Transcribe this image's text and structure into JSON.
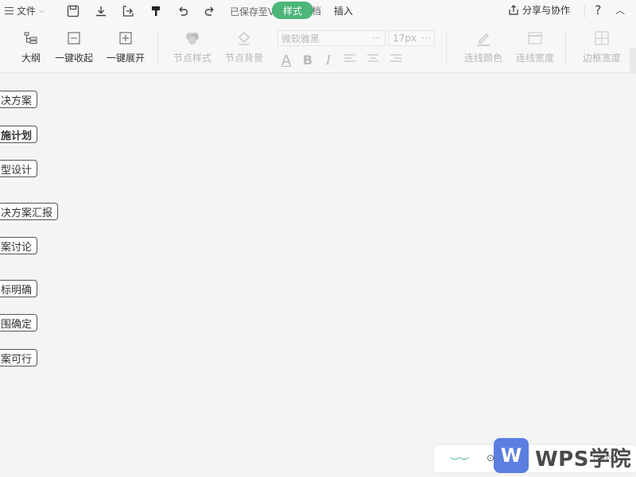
{
  "menubar": {
    "file_label": "文件",
    "saved_text": "已保存至V",
    "tab_style": "样式",
    "tab_hidden_fragment": "档",
    "tab_insert": "插入",
    "share_label": "分享与协作",
    "help_label": "?",
    "collapse_label": "︿"
  },
  "toolbar": {
    "outline": "大纲",
    "collapse_all": "一键收起",
    "expand_all": "一键展开",
    "node_style": "节点样式",
    "node_background": "节点背景",
    "font_name": "微软雅黑",
    "font_size": "17px",
    "more": "···",
    "line_color": "连线颜色",
    "line_width": "连线宽度",
    "border_width": "边框宽度",
    "fmt_text_color": "A",
    "fmt_bold": "B",
    "fmt_italic": "I"
  },
  "nodes": [
    {
      "text": "决方案",
      "bold": false
    },
    {
      "text": "施计划",
      "bold": true
    },
    {
      "text": "型设计",
      "bold": false
    },
    {
      "text": "决方案汇报",
      "bold": false
    },
    {
      "text": "案讨论",
      "bold": false
    },
    {
      "text": "标明确",
      "bold": false
    },
    {
      "text": "围确定",
      "bold": false
    },
    {
      "text": "案可行",
      "bold": false
    }
  ],
  "watermark": {
    "logo_letter": "W",
    "text": "WPS学院"
  },
  "status": {
    "zoom_text": "100%"
  },
  "colors": {
    "accent": "#4cb57a",
    "wps_blue": "#5b7ee0"
  }
}
